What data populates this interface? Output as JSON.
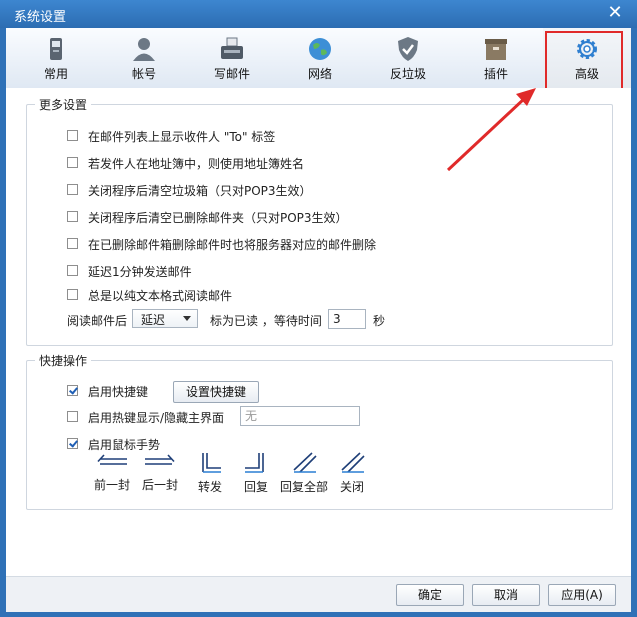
{
  "window": {
    "title": "系统设置",
    "close_icon": "close-icon"
  },
  "toolbar": {
    "items": [
      {
        "label": "常用",
        "icon": "phone-icon"
      },
      {
        "label": "帐号",
        "icon": "user-icon"
      },
      {
        "label": "写邮件",
        "icon": "typewriter-icon"
      },
      {
        "label": "网络",
        "icon": "globe-icon"
      },
      {
        "label": "反垃圾",
        "icon": "shield-icon"
      },
      {
        "label": "插件",
        "icon": "box-icon"
      },
      {
        "label": "高级",
        "icon": "gear-icon"
      }
    ],
    "active": "高级"
  },
  "more_settings": {
    "legend": "更多设置",
    "options": [
      {
        "label": "在邮件列表上显示收件人 \"To\" 标签",
        "checked": false
      },
      {
        "label": "若发件人在地址簿中，则使用地址簿姓名",
        "checked": false
      },
      {
        "label": "关闭程序后清空垃圾箱（只对POP3生效）",
        "checked": false
      },
      {
        "label": "关闭程序后清空已删除邮件夹（只对POP3生效）",
        "checked": false
      },
      {
        "label": "在已删除邮件箱删除邮件时也将服务器对应的邮件删除",
        "checked": false
      },
      {
        "label": "延迟1分钟发送邮件",
        "checked": false
      },
      {
        "label": "总是以纯文本格式阅读邮件",
        "checked": false
      }
    ],
    "read_row": {
      "prefix": "阅读邮件后",
      "select_value": "延迟",
      "middle": "标为已读 ，等待时间",
      "seconds": "3",
      "suffix": "秒"
    }
  },
  "shortcuts": {
    "legend": "快捷操作",
    "enable_hotkeys": {
      "label": "启用快捷键",
      "checked": true
    },
    "set_hotkeys_button": "设置快捷键",
    "show_hide_hotkey": {
      "label": "启用热键显示/隐藏主界面",
      "checked": false
    },
    "hotkey_value": "无",
    "mouse_gestures": {
      "label": "启用鼠标手势",
      "checked": true
    },
    "gestures": [
      "前一封",
      "后一封",
      "转发",
      "回复",
      "回复全部",
      "关闭"
    ]
  },
  "footer": {
    "ok": "确定",
    "cancel": "取消",
    "apply": "应用(A)"
  },
  "colors": {
    "titlebar": "#2f71b7",
    "highlight_box": "#e02a2a",
    "gesture_blue": "#1f5fb5"
  }
}
